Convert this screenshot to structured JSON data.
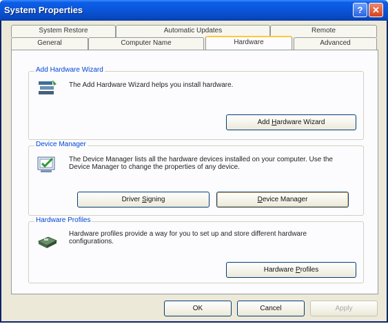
{
  "window": {
    "title": "System Properties"
  },
  "titlebar": {
    "help": "?",
    "close": "✕"
  },
  "tabs_row1": [
    "System Restore",
    "Automatic Updates",
    "Remote"
  ],
  "tabs_row2": [
    "General",
    "Computer Name",
    "Hardware",
    "Advanced"
  ],
  "active_tab": "Hardware",
  "wizard": {
    "label": "Add Hardware Wizard",
    "description": "The Add Hardware Wizard helps you install hardware.",
    "button_pre": "Add ",
    "button_accel": "H",
    "button_post": "ardware Wizard"
  },
  "device_manager": {
    "label": "Device Manager",
    "description": "The Device Manager lists all the hardware devices installed on your computer. Use the Device Manager to change the properties of any device.",
    "signing_pre": "Driver ",
    "signing_accel": "S",
    "signing_post": "igning",
    "manager_pre": "",
    "manager_accel": "D",
    "manager_post": "evice Manager"
  },
  "profiles": {
    "label": "Hardware Profiles",
    "description": "Hardware profiles provide a way for you to set up and store different hardware configurations.",
    "button_pre": "Hardware ",
    "button_accel": "P",
    "button_post": "rofiles"
  },
  "footer": {
    "ok": "OK",
    "cancel": "Cancel",
    "apply": "Apply"
  }
}
